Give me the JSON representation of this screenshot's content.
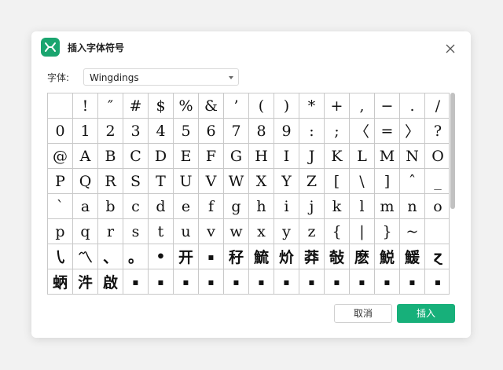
{
  "dialog": {
    "title": "插入字体符号",
    "font_label": "字体:",
    "font_value": "Wingdings",
    "cancel_label": "取消",
    "insert_label": "插入",
    "accent_color": "#17b07a"
  },
  "symbols": [
    " ",
    "!",
    "″",
    "#",
    "$",
    "%",
    "&",
    "’",
    "(",
    ")",
    "*",
    "+",
    ",",
    "−",
    ".",
    "/",
    "0",
    "1",
    "2",
    "3",
    "4",
    "5",
    "6",
    "7",
    "8",
    "9",
    ":",
    ";",
    "〈",
    "=",
    "〉",
    "?",
    "@",
    "A",
    "B",
    "C",
    "D",
    "E",
    "F",
    "G",
    "H",
    "I",
    "J",
    "K",
    "L",
    "M",
    "N",
    "O",
    "P",
    "Q",
    "R",
    "S",
    "T",
    "U",
    "V",
    "W",
    "X",
    "Y",
    "Z",
    "[",
    "\\",
    "]",
    "ˆ",
    "_",
    "`",
    "a",
    "b",
    "c",
    "d",
    "e",
    "f",
    "g",
    "h",
    "i",
    "j",
    "k",
    "l",
    "m",
    "n",
    "o",
    "p",
    "q",
    "r",
    "s",
    "t",
    "u",
    "v",
    "w",
    "x",
    "y",
    "z",
    "{",
    "|",
    "}",
    "~",
    " ",
    "㇂",
    "〽",
    "、",
    "。",
    "•",
    "开",
    "▪",
    "秄",
    "鯍",
    "炌",
    "莽",
    "敧",
    "麽",
    "鮵",
    "鰀",
    "ɀ",
    "蛃",
    "汼",
    "啟",
    "▪",
    "▪",
    "▪",
    "▪",
    "▪",
    "▪",
    "▪",
    "▪",
    "▪",
    "▪",
    "▪",
    "▪",
    "▪"
  ]
}
